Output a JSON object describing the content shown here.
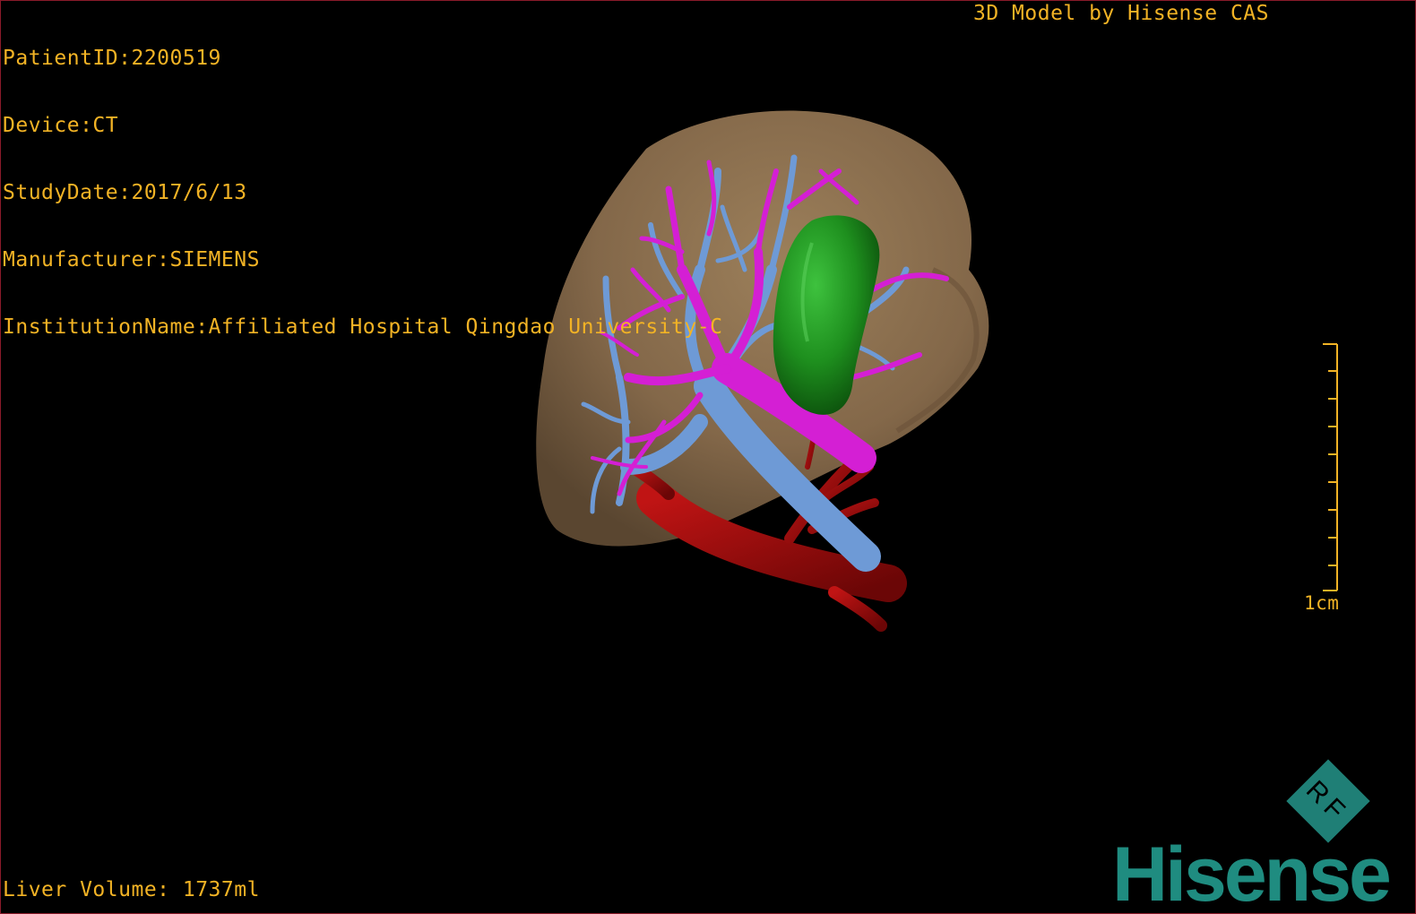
{
  "patient_info": {
    "patient_id": "PatientID:2200519",
    "device": "Device:CT",
    "study_date": "StudyDate:2017/6/13",
    "manufacturer": "Manufacturer:SIEMENS",
    "institution": "InstitutionName:Affiliated Hospital Qingdao University-C"
  },
  "model_credit": "3D Model by Hisense CAS",
  "liver_volume": "Liver Volume: 1737ml",
  "scale": {
    "label": "1cm"
  },
  "badge": {
    "text": "RF"
  },
  "brand": {
    "name": "Hisense"
  },
  "colors": {
    "overlay_text": "#f2b325",
    "liver": "#8a6d4d",
    "gallbladder": "#1e8f1e",
    "portal_vein": "#d41fd4",
    "hepatic_vein": "#6e9ad6",
    "artery": "#9e0b0b",
    "brand": "#1f8c80"
  },
  "model_structures": [
    "liver",
    "gallbladder",
    "portal-vein",
    "hepatic-vein",
    "artery"
  ]
}
